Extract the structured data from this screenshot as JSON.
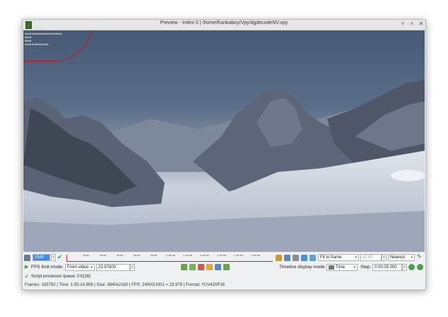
{
  "window": {
    "title": "Preview - Index 0 | /home/frankaboy/Vpy/dgdecodeNV.vpy",
    "buttons": {
      "minimize": "˅",
      "maximize": "˄",
      "close": "✕"
    }
  },
  "overlay": {
    "lines": [
      "▮▮▮▮▮▮▮▮▮▮▮▮▮▮▮▮▮▮▮▮▮▮",
      "▮▮▮▮",
      "▮▮▮▮",
      "▮▮▮▮▮▮▮▮▮▮▮▮▮▮"
    ]
  },
  "toolbar": {
    "frame_value": "1540",
    "timeline_ticks": [
      "10:00",
      "20:00",
      "30:00",
      "40:00",
      "50:00",
      "1:00:00",
      "1:10:00",
      "1:20:00",
      "1:30:00",
      "1:40:00",
      "1:50:00"
    ],
    "zoom_mode": "Fit to frame",
    "zoom_ratio": "x2.00",
    "scale_mode": "Nearest",
    "fps_limit_label": "FPS limit mode:",
    "fps_limit_mode": "From video",
    "fps_value": "23.97600",
    "timeline_display_label": "Timeline display mode:",
    "timeline_display_mode": "Time",
    "step_label": "Step:",
    "step_value": "0:00:05.000"
  },
  "status": {
    "queue": "Script processor queue: 0:0(16)",
    "info": "Frames: 165792 | Time: 1:55:14.908 | Size: 3840x2160 | FPS: 24000/1001 = 23.976 | Format: YUV420P16"
  },
  "colors": {
    "accent": "#3d8ee8",
    "annotation": "#c0141c"
  }
}
